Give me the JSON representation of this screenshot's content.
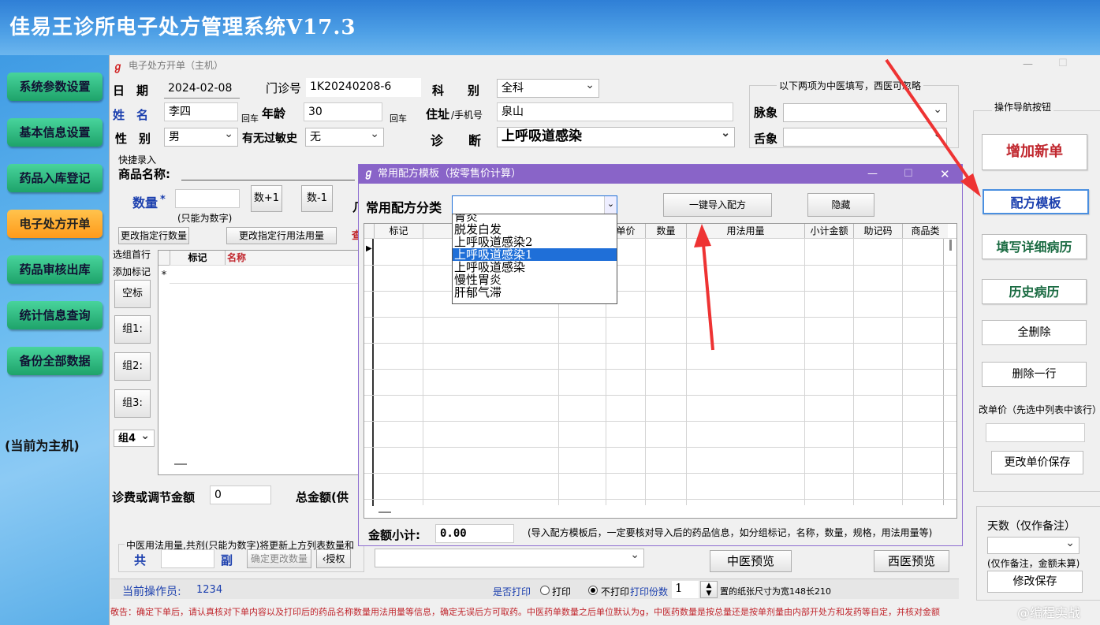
{
  "app": {
    "title": "佳易王诊所电子处方管理系统V17.3",
    "host_label": "(当前为主机)"
  },
  "nav": [
    {
      "label": "系统参数设置",
      "active": false
    },
    {
      "label": "基本信息设置",
      "active": false
    },
    {
      "label": "药品入库登记",
      "active": false
    },
    {
      "label": "电子处方开单",
      "active": true
    },
    {
      "label": "药品审核出库",
      "active": false
    },
    {
      "label": "统计信息查询",
      "active": false
    },
    {
      "label": "备份全部数据",
      "active": false
    }
  ],
  "window": {
    "title": "电子处方开单（主机）"
  },
  "form": {
    "date_label": "日　期",
    "date": "2024-02-08",
    "clinic_label": "门诊号",
    "clinic_no": "1K20240208-6",
    "dept_label": "科　　别",
    "dept": "全科",
    "tcm_note": "以下两项为中医填写，西医可忽略",
    "name_label": "姓　名",
    "name": "李四",
    "enter1": "回车",
    "age_label": "年龄",
    "age": "30",
    "enter2": "回车",
    "addr_label": "住址",
    "phone_label": "/手机号",
    "addr": "泉山",
    "pulse_label": "脉象",
    "tongue_label": "舌象",
    "gender_label": "性　别",
    "gender": "男",
    "allergy_label": "有无过敏史",
    "allergy": "无",
    "diag_label": "诊　　断",
    "diagnosis": "上呼吸道感染"
  },
  "quick": {
    "title": "快捷录入",
    "product_label": "商品名称:",
    "qty_label": "数量",
    "qty_star": "*",
    "qty_hint": "(只能为数字)",
    "plus": "数+1",
    "minus": "数-1",
    "change_row_qty": "更改指定行数量",
    "change_row_usage": "更改指定行用法用量",
    "select_first": "选组首行",
    "add_mark": "添加标记",
    "blank": "空标",
    "g1": "组1:",
    "g2": "组2:",
    "g3": "组3:",
    "g4": "组4",
    "col_mark": "标记",
    "col_name": "名称",
    "new_row": "*"
  },
  "totals": {
    "fee_label": "诊费或调节金额",
    "fee": "0",
    "total_label": "总金额(供"
  },
  "tcm_bar": {
    "note": "中医用法用量,共剂(只能为数字)将更新上方列表数量和",
    "gong": "共",
    "fu": "副",
    "confirm": "确定更改数量",
    "auth": "‹授权",
    "tcm_preview": "中医预览",
    "west_preview": "西医预览"
  },
  "status": {
    "operator_label": "当前操作员:",
    "operator": "1234",
    "print_label": "是否打印",
    "print": "打印",
    "noprint": "不打印",
    "copies_label": "打印份数",
    "copies": "1",
    "paper": "置的纸张尺寸为宽148长210"
  },
  "warning": "敬告：确定下单后，请认真核对下单内容以及打印后的药品名称数量用法用量等信息，确定无误后方可取药。中医药单数量之后单位默认为g，中医药数量是按总量还是按单剂量由内部开处方和发药等自定，并核对金额",
  "watermark": "@编程实战",
  "right": {
    "title": "操作导航按钮",
    "add": "增加新单",
    "template": "配方模板",
    "record": "填写详细病历",
    "history": "历史病历",
    "del_all": "全删除",
    "del_row": "删除一行",
    "price_label": "改单价（先选中列表中该行）",
    "price_save": "更改单价保存",
    "days_label": "天数（仅作备注）",
    "days_note": "(仅作备注，金额未算)",
    "save": "修改保存"
  },
  "dialog": {
    "title": "常用配方模板（按零售价计算）",
    "cat_label": "常用配方分类",
    "import": "一键导入配方",
    "hide": "隐藏",
    "columns": [
      "标记",
      "单价",
      "数量",
      "用法用量",
      "小计金额",
      "助记码",
      "商品类"
    ],
    "options": [
      "胃炎",
      "脱发白发",
      "上呼吸道感染2",
      "上呼吸道感染1",
      "上呼吸道感染",
      "慢性胃炎",
      "肝郁气滞"
    ],
    "selected_index": 3,
    "amount_label": "金额小计:",
    "amount": "0.00",
    "tip": "(导入配方模板后，一定要核对导入后的药品信息，如分组标记，名称，数量，规格，用法用量等)"
  }
}
